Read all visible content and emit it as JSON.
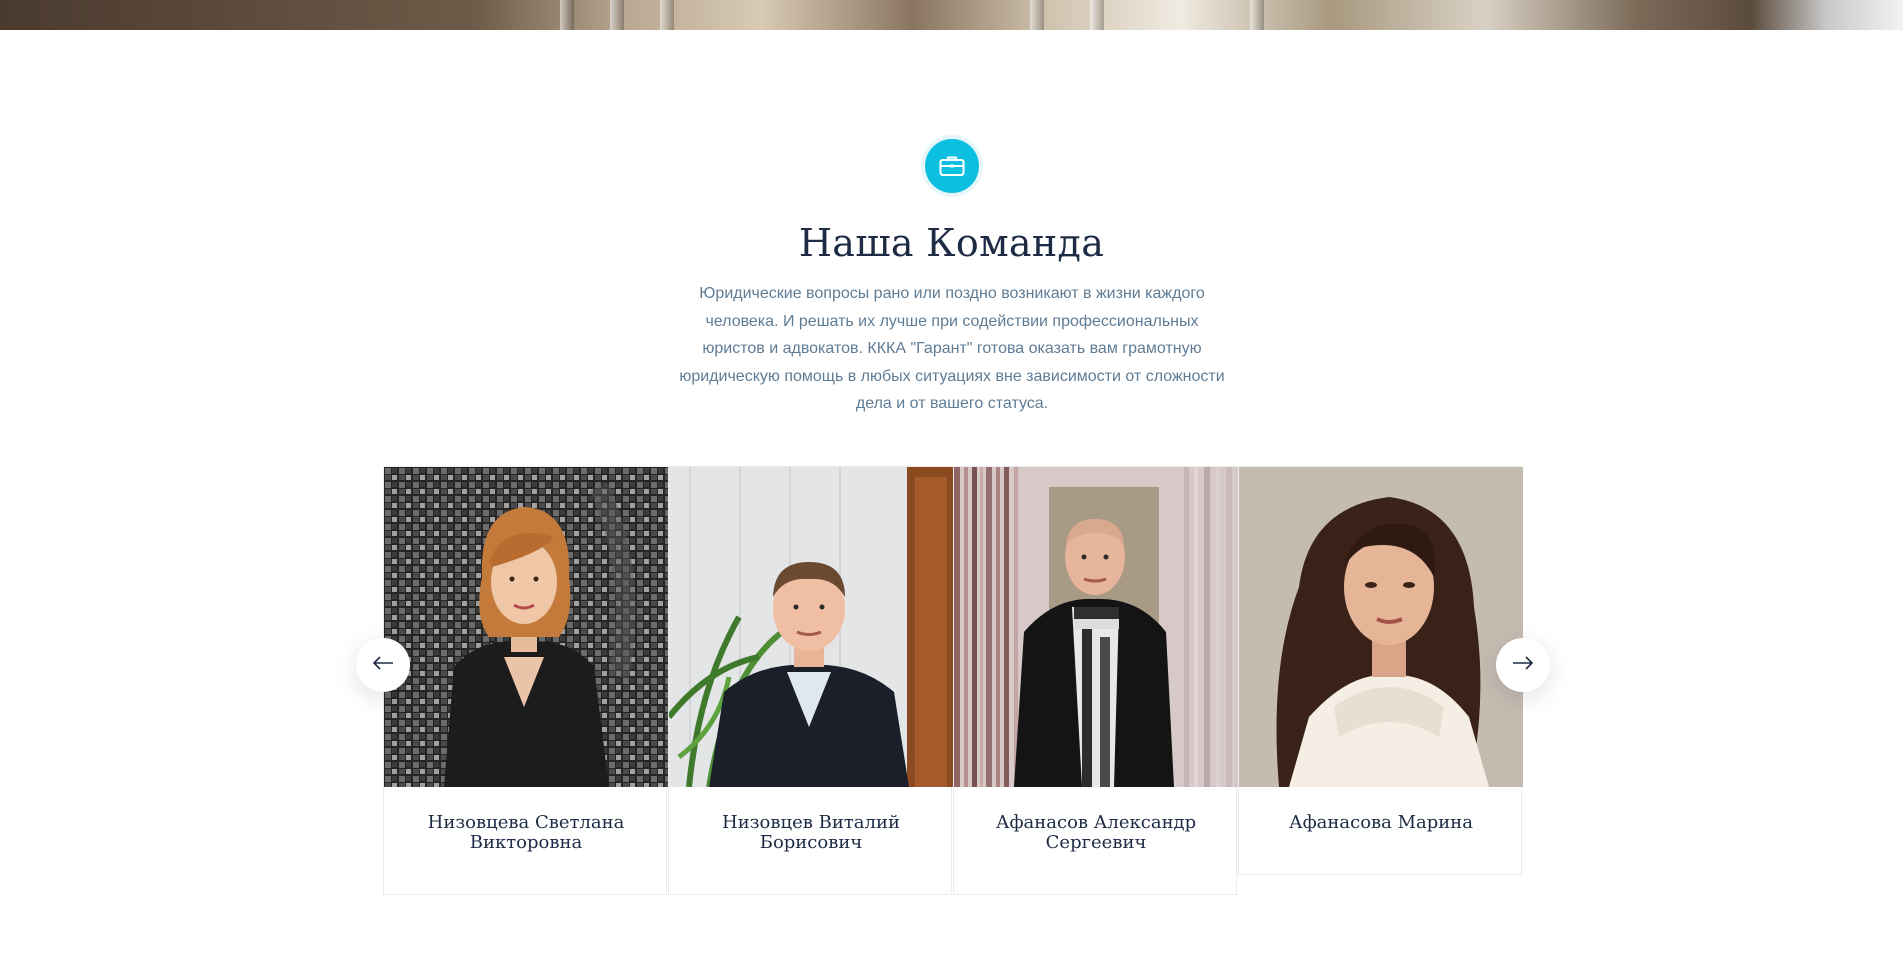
{
  "section": {
    "icon": "briefcase-icon",
    "title": "Наша Команда",
    "description": "Юридические вопросы рано или поздно возникают в жизни каждого человека. И решать их лучше при содействии профессиональных юристов и адвокатов. КККА \"Гарант\" готова оказать вам грамотную юридическую помощь в любых ситуациях вне зависимости от сложности дела и от вашего статуса."
  },
  "carousel": {
    "prev_icon": "arrow-left-icon",
    "next_icon": "arrow-right-icon",
    "members": [
      {
        "name": "Низовцева Светлана Викторовна"
      },
      {
        "name": "Низовцев Виталий Борисович"
      },
      {
        "name": "Афанасов Александр Сергеевич"
      },
      {
        "name": "Афанасова Марина"
      }
    ]
  },
  "colors": {
    "accent": "#0bbfe0",
    "heading": "#1d2b45",
    "text": "#5f7c95"
  }
}
